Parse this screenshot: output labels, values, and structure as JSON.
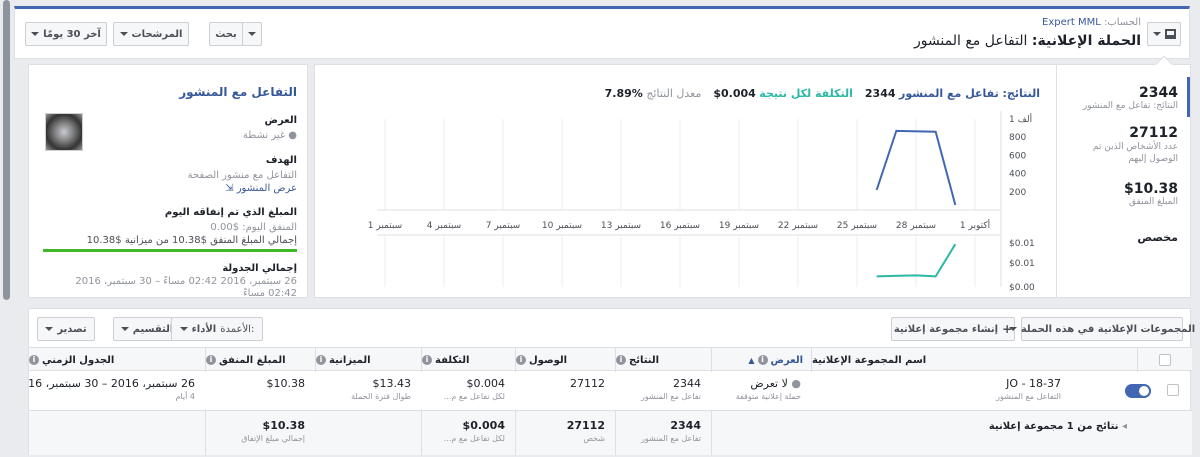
{
  "header": {
    "account_label": "الحساب:",
    "account_name": "Expert MML",
    "campaign_title_prefix": "الحملة الإعلانية:",
    "campaign_title_name": "التفاعل مع المنشور",
    "date_range": "آخر 30 يومًا",
    "filters": "المرشحات",
    "search": "بحث"
  },
  "stats": {
    "results_value": "2344",
    "results_label": "النتائج: تفاعل مع المنشور",
    "reach_value": "27112",
    "reach_label": "عدد الأشخاص الذين تم الوصول إليهم",
    "spend_value": "$10.38",
    "spend_label": "المبلغ المنفق",
    "custom": "مخصص"
  },
  "chart_header": {
    "results_value": "2344",
    "results_label": "النتائج: تفاعل مع المنشور",
    "cpr_value": "$0.004",
    "cpr_label": "التكلفة لكل نتيجة",
    "rate_value": "7.89%",
    "rate_label": "معدل النتائج"
  },
  "chart_data": [
    {
      "type": "line",
      "name": "results",
      "color": "#4267b2",
      "yticks": [
        "1 ألف",
        "800",
        "600",
        "400",
        "200"
      ],
      "ylim": [
        0,
        1000
      ],
      "x": [
        "سبتمبر 1",
        "سبتمبر 4",
        "سبتمبر 7",
        "سبتمبر 10",
        "سبتمبر 13",
        "سبتمبر 16",
        "سبتمبر 19",
        "سبتمبر 22",
        "سبتمبر 25",
        "سبتمبر 28",
        "أكتوبر 1"
      ],
      "series": [
        {
          "points": [
            [
              "سبتمبر 26",
              220
            ],
            [
              "سبتمبر 27",
              870
            ],
            [
              "سبتمبر 29",
              860
            ],
            [
              "سبتمبر 30",
              55
            ]
          ]
        }
      ]
    },
    {
      "type": "line",
      "name": "cost per result",
      "color": "#2bb8a5",
      "yticks": [
        "$0.01",
        "$0.01",
        "$0.00"
      ],
      "series": [
        {
          "points": [
            [
              "سبتمبر 26",
              0.0018
            ],
            [
              "سبتمبر 28",
              0.002
            ],
            [
              "سبتمبر 29",
              0.0018
            ],
            [
              "سبتمبر 30",
              0.0085
            ]
          ]
        }
      ]
    }
  ],
  "side": {
    "title": "التفاعل مع المنشور",
    "delivery_h": "العرض",
    "delivery_v": "غير نشطة",
    "objective_h": "الهدف",
    "objective_v": "التفاعل مع منشور الصفحة",
    "view_post": "عرض المنشور",
    "spent_h": "المبلغ الذي تم إنفاقه اليوم",
    "spent_today": "المنفق اليوم: $0.00",
    "spent_total": "إجمالي المبلغ المنفق $10.38 من ميزانية $10.38",
    "spend_progress": 1.0,
    "schedule_h": "إجمالي الجدولة",
    "schedule_v": "26 سبتمبر، 2016 02:42 مساءً – 30 سبتمبر، 2016 02:42 مساءً"
  },
  "toolbar": {
    "adsets_dropdown": "المجموعات الإعلانية في هذه الحملة",
    "create_adset": "إنشاء مجموعة إعلانية",
    "columns_label": "الأعمدة:",
    "columns_value": "الأداء",
    "breakdown": "التقسيم",
    "export": "تصدير"
  },
  "table": {
    "headers": {
      "name": "اسم المجموعة الإعلانية",
      "delivery": "العرض",
      "results": "النتائج",
      "reach": "الوصول",
      "cost": "التكلفة",
      "budget": "الميزانية",
      "spent": "المبلغ المنفق",
      "schedule": "الجدول الزمني"
    },
    "row": {
      "name": "JO - 18-37",
      "name_sub": "التفاعل مع المنشور",
      "delivery": "لا تعرض",
      "delivery_sub": "حملة إعلانية متوقفة",
      "results": "2344",
      "results_sub": "تفاعل مع المنشور",
      "reach": "27112",
      "cost": "$0.004",
      "cost_sub": "لكل تفاعل مع م...",
      "budget": "$13.43",
      "budget_sub": "طوال فترة الحملة",
      "spent": "$10.38",
      "schedule": "26 سبتمبر، 2016 – 30 سبتمبر، 2016",
      "schedule_sub": "4 أيام"
    },
    "totals": {
      "label": "نتائج من 1 مجموعة إعلانية",
      "results": "2344",
      "results_sub": "تفاعل مع المنشور",
      "reach": "27112",
      "reach_sub": "شخص",
      "cost": "$0.004",
      "cost_sub": "لكل تفاعل مع م...",
      "spent": "$10.38",
      "spent_sub": "إجمالي مبلغ الإنفاق"
    }
  }
}
